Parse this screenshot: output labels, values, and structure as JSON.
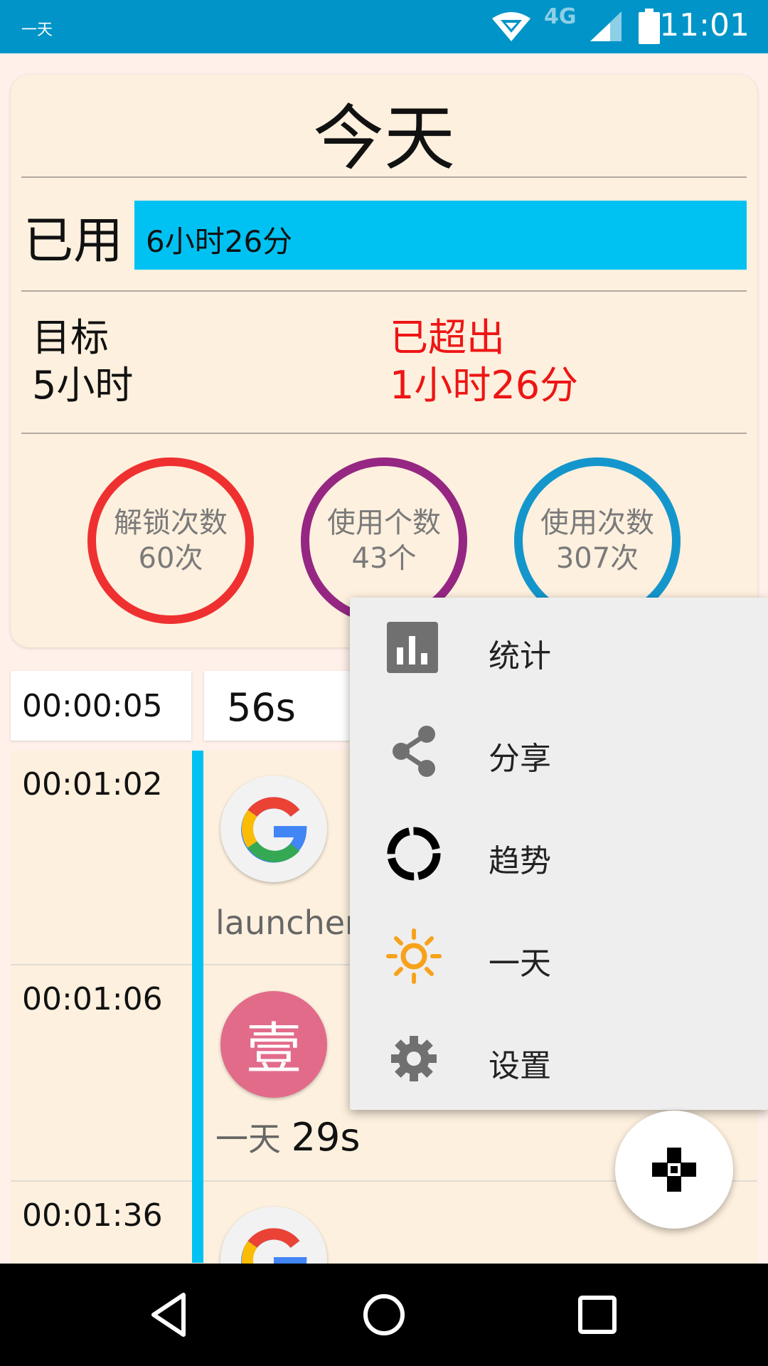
{
  "status_bar": {
    "app_label": "一天",
    "network": "4G",
    "time": "11:01"
  },
  "summary": {
    "title": "今天",
    "used_label": "已用",
    "used_value": "6小时26分",
    "goal_label": "目标",
    "goal_value": "5小时",
    "over_label": "已超出",
    "over_value": "1小时26分",
    "stats": [
      {
        "label": "解锁次数",
        "value": "60次",
        "color": "#ef3030"
      },
      {
        "label": "使用个数",
        "value": "43个",
        "color": "#952783"
      },
      {
        "label": "使用次数",
        "value": "307次",
        "color": "#1496cc"
      }
    ]
  },
  "timeline": {
    "first": {
      "time": "00:00:05",
      "duration": "56s"
    },
    "rows": [
      {
        "time": "00:01:02",
        "app": "launcher",
        "icon": "google-icon",
        "duration": ""
      },
      {
        "time": "00:01:06",
        "app": "一天",
        "icon": "yi-icon",
        "icon_text": "壹",
        "duration": "29s"
      },
      {
        "time": "00:01:36",
        "app": "",
        "icon": "google-icon",
        "duration": ""
      }
    ]
  },
  "menu": {
    "items": [
      {
        "label": "统计",
        "icon": "bar-chart-icon"
      },
      {
        "label": "分享",
        "icon": "share-icon"
      },
      {
        "label": "趋势",
        "icon": "trend-circle-icon"
      },
      {
        "label": "一天",
        "icon": "sun-icon"
      },
      {
        "label": "设置",
        "icon": "gear-icon"
      }
    ]
  },
  "fab": {
    "icon": "gamepad-icon"
  },
  "colors": {
    "status_bar": "#0094c8",
    "used_bar": "#00c2f2",
    "over": "#ee1515"
  }
}
